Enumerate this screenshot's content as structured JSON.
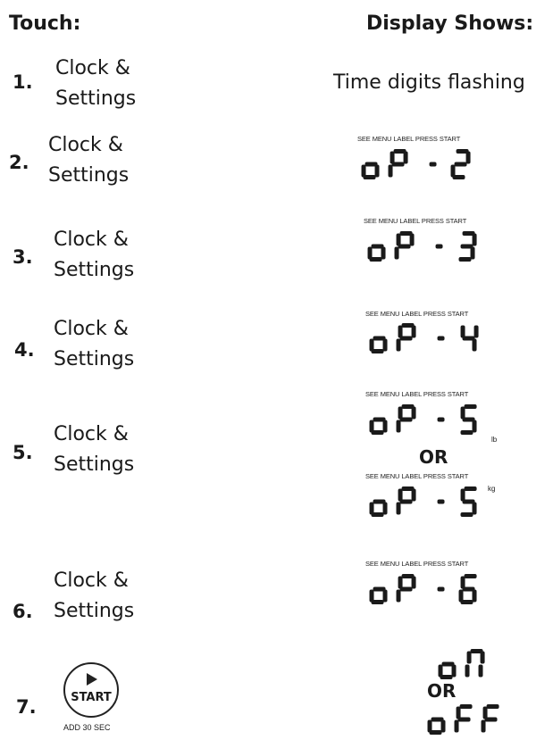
{
  "header": {
    "touch_label": "Touch:",
    "display_label": "Display Shows:"
  },
  "steps": [
    {
      "number": "1.",
      "touch": [
        "Clock &",
        "Settings"
      ],
      "display_text": "Time digits flashing"
    },
    {
      "number": "2.",
      "touch": [
        "Clock &",
        "Settings"
      ],
      "display_caption": "SEE MENU LABEL  PRESS START",
      "display_code": "oP -2"
    },
    {
      "number": "3.",
      "touch": [
        "Clock &",
        "Settings"
      ],
      "display_caption": "SEE MENU LABEL  PRESS START",
      "display_code": "oP -3"
    },
    {
      "number": "4.",
      "touch": [
        "Clock &",
        "Settings"
      ],
      "display_caption": "SEE MENU LABEL  PRESS START",
      "display_code": "oP -4"
    },
    {
      "number": "5.",
      "touch": [
        "Clock &",
        "Settings"
      ],
      "display_a": {
        "caption": "SEE MENU LABEL  PRESS START",
        "code": "oP -5",
        "unit": "lb"
      },
      "or": "OR",
      "display_b": {
        "caption": "SEE MENU LABEL  PRESS START",
        "code": "oP -5",
        "unit": "kg"
      }
    },
    {
      "number": "6.",
      "touch": [
        "Clock &",
        "Settings"
      ],
      "display_caption": "SEE MENU LABEL  PRESS START",
      "display_code": "oP -6"
    },
    {
      "number": "7.",
      "button": {
        "icon": "play-icon",
        "label": "START",
        "sublabel": "ADD 30 SEC"
      },
      "display_a": "on",
      "or": "OR",
      "display_b": "oFF"
    }
  ]
}
